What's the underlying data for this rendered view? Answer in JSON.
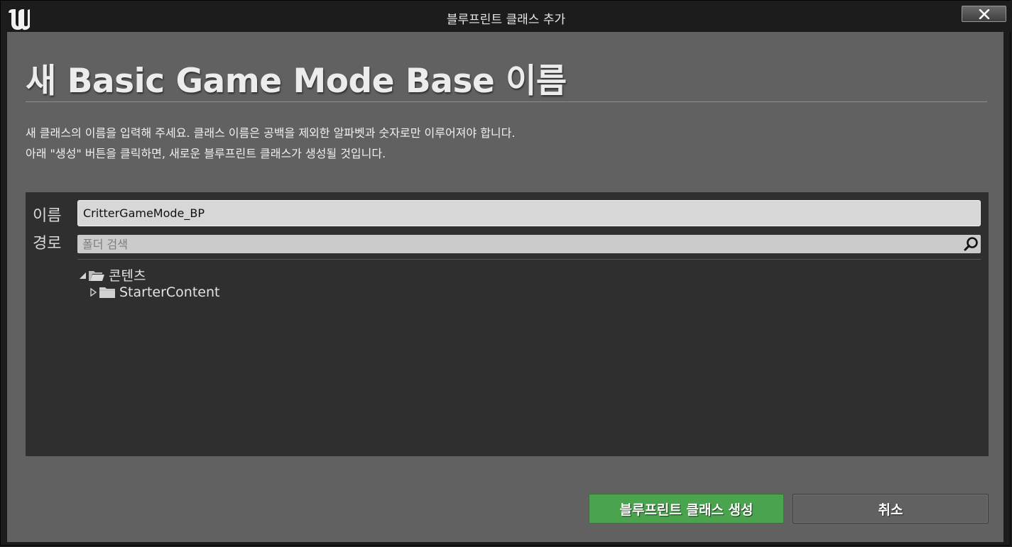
{
  "window": {
    "title": "블루프린트 클래스 추가",
    "close_label": "✕"
  },
  "dialog": {
    "heading": "새 Basic Game Mode Base 이름",
    "description_line1": "새 클래스의 이름을 입력해 주세요. 클래스 이름은 공백을 제외한 알파벳과 숫자로만 이루어져야 합니다.",
    "description_line2": "아래 \"생성\" 버튼을 클릭하면, 새로운 블루프린트 클래스가 생성될 것입니다."
  },
  "form": {
    "name_label": "이름",
    "name_value": "CritterGameMode_BP",
    "path_label": "경로",
    "search_placeholder": "폴더 검색"
  },
  "tree": {
    "items": [
      {
        "label": "콘텐츠",
        "expanded": true,
        "icon": "folder-open-icon"
      },
      {
        "label": "StarterContent",
        "expanded": false,
        "icon": "folder-icon"
      }
    ]
  },
  "buttons": {
    "create_label": "블루프린트 클래스 생성",
    "cancel_label": "취소"
  },
  "colors": {
    "create_button": "#4aa44e",
    "content_bg": "#616161",
    "panel_bg": "#2f2f2f"
  }
}
